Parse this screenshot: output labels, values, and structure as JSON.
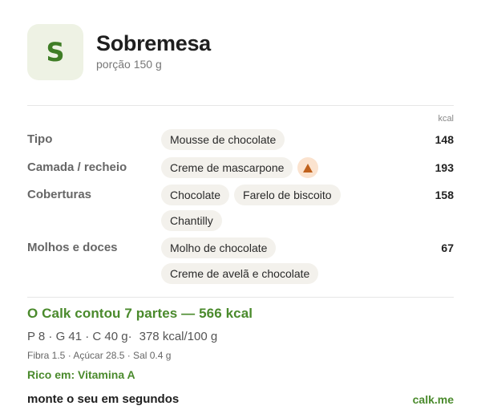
{
  "header": {
    "avatar_letter": "S",
    "title": "Sobremesa",
    "subtitle": "porção 150 g"
  },
  "table": {
    "kcal_header": "kcal",
    "rows": [
      {
        "label": "Tipo",
        "chips": [
          "Mousse de chocolate"
        ],
        "kcal": "148"
      },
      {
        "label": "Camada / recheio",
        "chips": [
          "Creme de mascarpone"
        ],
        "warning_icon": "warning-triangle-icon",
        "kcal": "193"
      },
      {
        "label": "Coberturas",
        "chips": [
          "Chocolate",
          "Farelo de biscoito",
          "Chantilly"
        ],
        "kcal": "158"
      },
      {
        "label": "Molhos e doces",
        "chips": [
          "Molho de chocolate",
          "Creme de avelã e chocolate"
        ],
        "kcal": "67"
      }
    ]
  },
  "summary": {
    "headline": "O Calk contou 7 partes — 566 kcal",
    "macros_main": "P 8 · G 41 · C 40 g",
    "macros_density": "378 kcal/100 g",
    "micros": "Fibra 1.5 · Açúcar 28.5 · Sal 0.4 g",
    "rich_in": "Rico em: Vitamina A"
  },
  "footer": {
    "cta": "monte o seu em segundos",
    "brand": "calk.me"
  },
  "colors": {
    "accent": "#4a8a2c",
    "avatar_bg": "#eef2e4",
    "chip_bg": "#f3f1ec",
    "warning_bg": "#fbe3cf",
    "warning_fg": "#c0611c"
  }
}
